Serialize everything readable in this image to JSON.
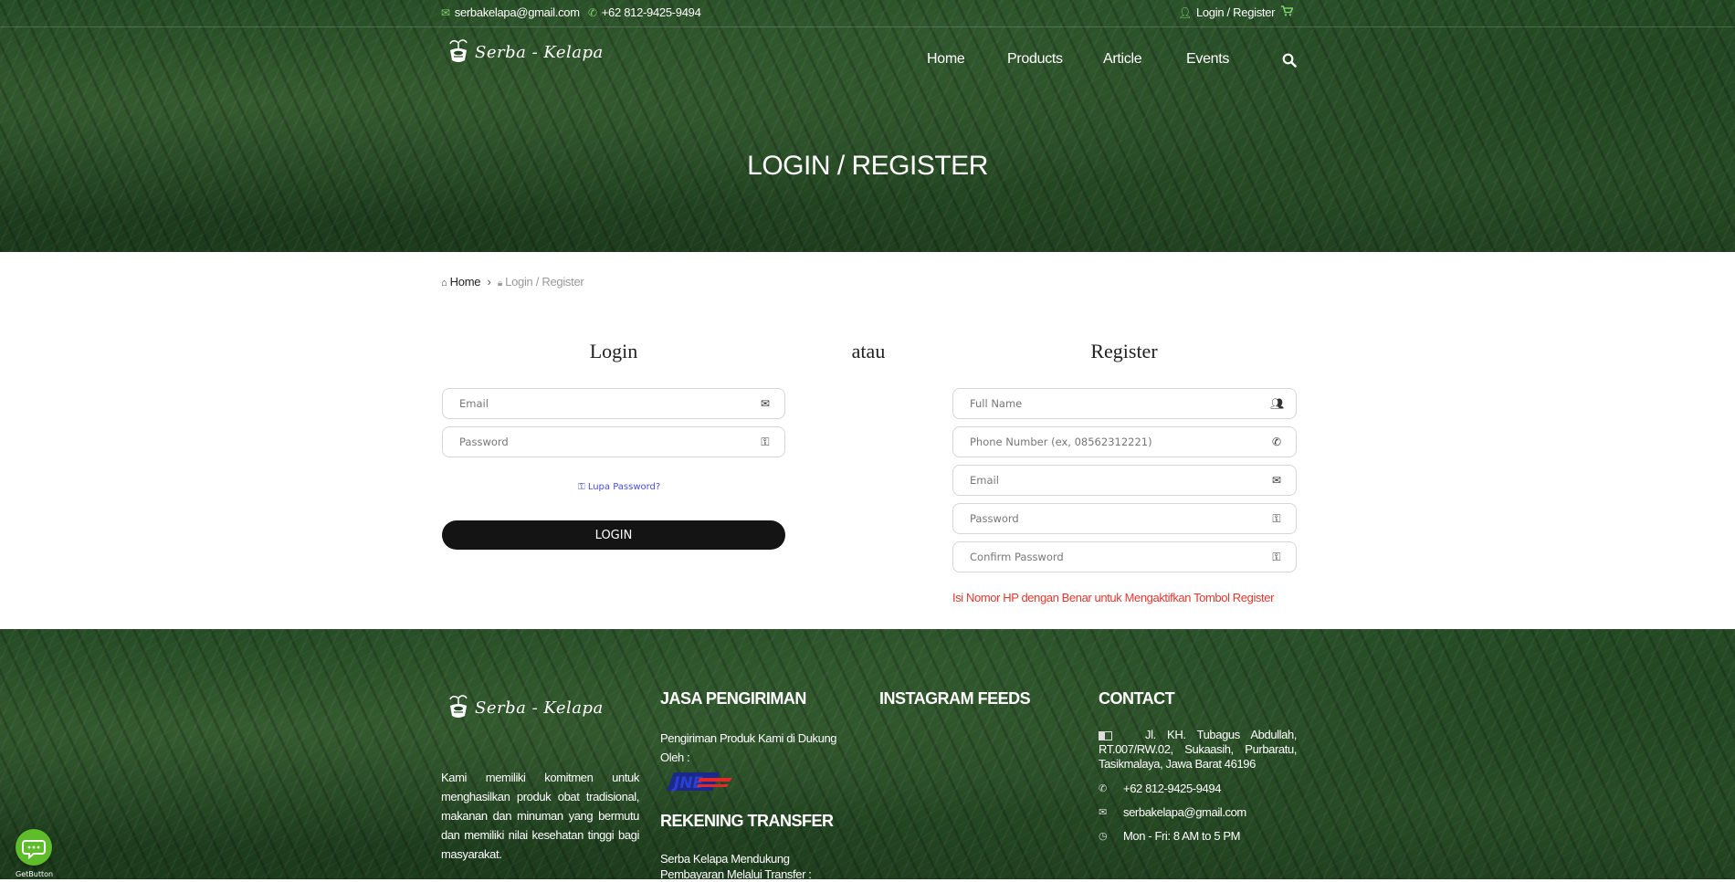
{
  "topbar": {
    "email": "serbakelapa@gmail.com",
    "phone": "+62 812-9425-9494",
    "account_link": "Login / Register"
  },
  "brand": {
    "name": "Serba - Kelapa"
  },
  "nav": {
    "items": [
      "Home",
      "Products",
      "Article",
      "Events"
    ]
  },
  "hero": {
    "title": "LOGIN / REGISTER"
  },
  "breadcrumb": {
    "home": "Home",
    "current": "Login / Register"
  },
  "login": {
    "title": "Login",
    "email_placeholder": "Email",
    "password_placeholder": "Password",
    "forgot_label": "Lupa Password?",
    "button_label": "LOGIN"
  },
  "separator": "atau",
  "register": {
    "title": "Register",
    "fullname_placeholder": "Full Name",
    "phone_placeholder": "Phone Number (ex, 08562312221)",
    "email_placeholder": "Email",
    "password_placeholder": "Password",
    "confirm_placeholder": "Confirm Password",
    "notice": "Isi Nomor HP dengan Benar untuk Mengaktifkan Tombol Register"
  },
  "footer": {
    "about": "Kami memiliki komitmen untuk menghasilkan produk obat tradisional, makanan dan minuman yang bermutu dan memiliki nilai kesehatan tinggi bagi masyarakat.",
    "shipping": {
      "title": "JASA PENGIRIMAN",
      "text": "Pengiriman Produk Kami di Dukung Oleh :",
      "courier": "JNE"
    },
    "transfer": {
      "title": "REKENING TRANSFER",
      "text": "Serba Kelapa Mendukung Pembayaran Melalui Transfer :"
    },
    "instagram": {
      "title": "INSTAGRAM FEEDS"
    },
    "contact": {
      "title": "CONTACT",
      "address": "Jl. KH. Tubagus Abdullah, RT.007/RW.02, Sukaasih, Purbaratu, Tasikmalaya, Jawa Barat 46196",
      "phone": "+62 812-9425-9494",
      "email": "serbakelapa@gmail.com",
      "hours": "Mon - Fri: 8 AM to 5 PM"
    }
  },
  "chat_widget": {
    "label": "GetButton"
  },
  "colors": {
    "accent_green": "#7fd36a",
    "warning_red": "#e2382f",
    "button_dark": "#141414",
    "link_blue": "#4a4fcf"
  }
}
